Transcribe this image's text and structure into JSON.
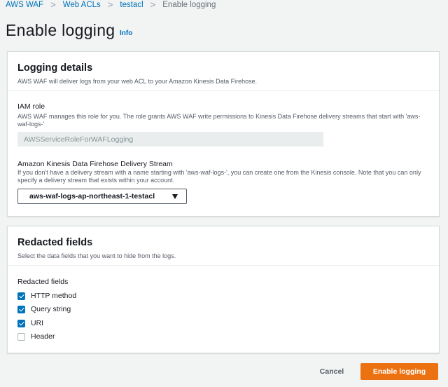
{
  "breadcrumb": {
    "items": [
      "AWS WAF",
      "Web ACLs",
      "testacl"
    ],
    "current": "Enable logging",
    "separator": ">"
  },
  "page": {
    "title": "Enable logging",
    "info_link": "Info"
  },
  "logging_details": {
    "title": "Logging details",
    "description": "AWS WAF will deliver logs from your web ACL to your Amazon Kinesis Data Firehose.",
    "iam_role": {
      "label": "IAM role",
      "description": "AWS WAF manages this role for you. The role grants AWS WAF write permissions to Kinesis Data Firehose delivery streams that start with 'aws-waf-logs-'",
      "value": "AWSServiceRoleForWAFLogging"
    },
    "delivery_stream": {
      "label": "Amazon Kinesis Data Firehose Delivery Stream",
      "description": "If you don't have a delivery stream with a name starting with 'aws-waf-logs-', you can create one from the Kinesis console. Note that you can only specify a delivery stream that exists within your account.",
      "selected": "aws-waf-logs-ap-northeast-1-testacl"
    }
  },
  "redacted_fields": {
    "title": "Redacted fields",
    "description": "Select the data fields that you want to hide from the logs.",
    "group_label": "Redacted fields",
    "options": [
      {
        "label": "HTTP method",
        "checked": true
      },
      {
        "label": "Query string",
        "checked": true
      },
      {
        "label": "URI",
        "checked": true
      },
      {
        "label": "Header",
        "checked": false
      }
    ]
  },
  "actions": {
    "cancel_label": "Cancel",
    "submit_label": "Enable logging"
  },
  "colors": {
    "link": "#0073bb",
    "primary": "#ec7211",
    "checkbox": "#0073bb",
    "background": "#f2f3f3"
  }
}
